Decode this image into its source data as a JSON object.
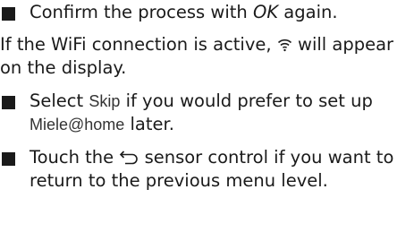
{
  "items": [
    {
      "type": "bullet",
      "pre": "Confirm the process with ",
      "term": "OK",
      "post": " again."
    },
    {
      "type": "paragraph",
      "pre": "If the WiFi connection is active, ",
      "icon": "wifi-icon",
      "post": " will appear on the display."
    },
    {
      "type": "bullet",
      "pre": "Select ",
      "term1": "Skip",
      "mid": " if you would prefer to set up ",
      "term2": "Miele@home",
      "post": " later."
    },
    {
      "type": "bullet",
      "pre": "Touch the ",
      "icon": "back-arrow-icon",
      "post": " sensor control if you want to return to the previous menu level."
    }
  ],
  "colors": {
    "text": "#1a1a1a",
    "bullet": "#1a1a1a"
  }
}
